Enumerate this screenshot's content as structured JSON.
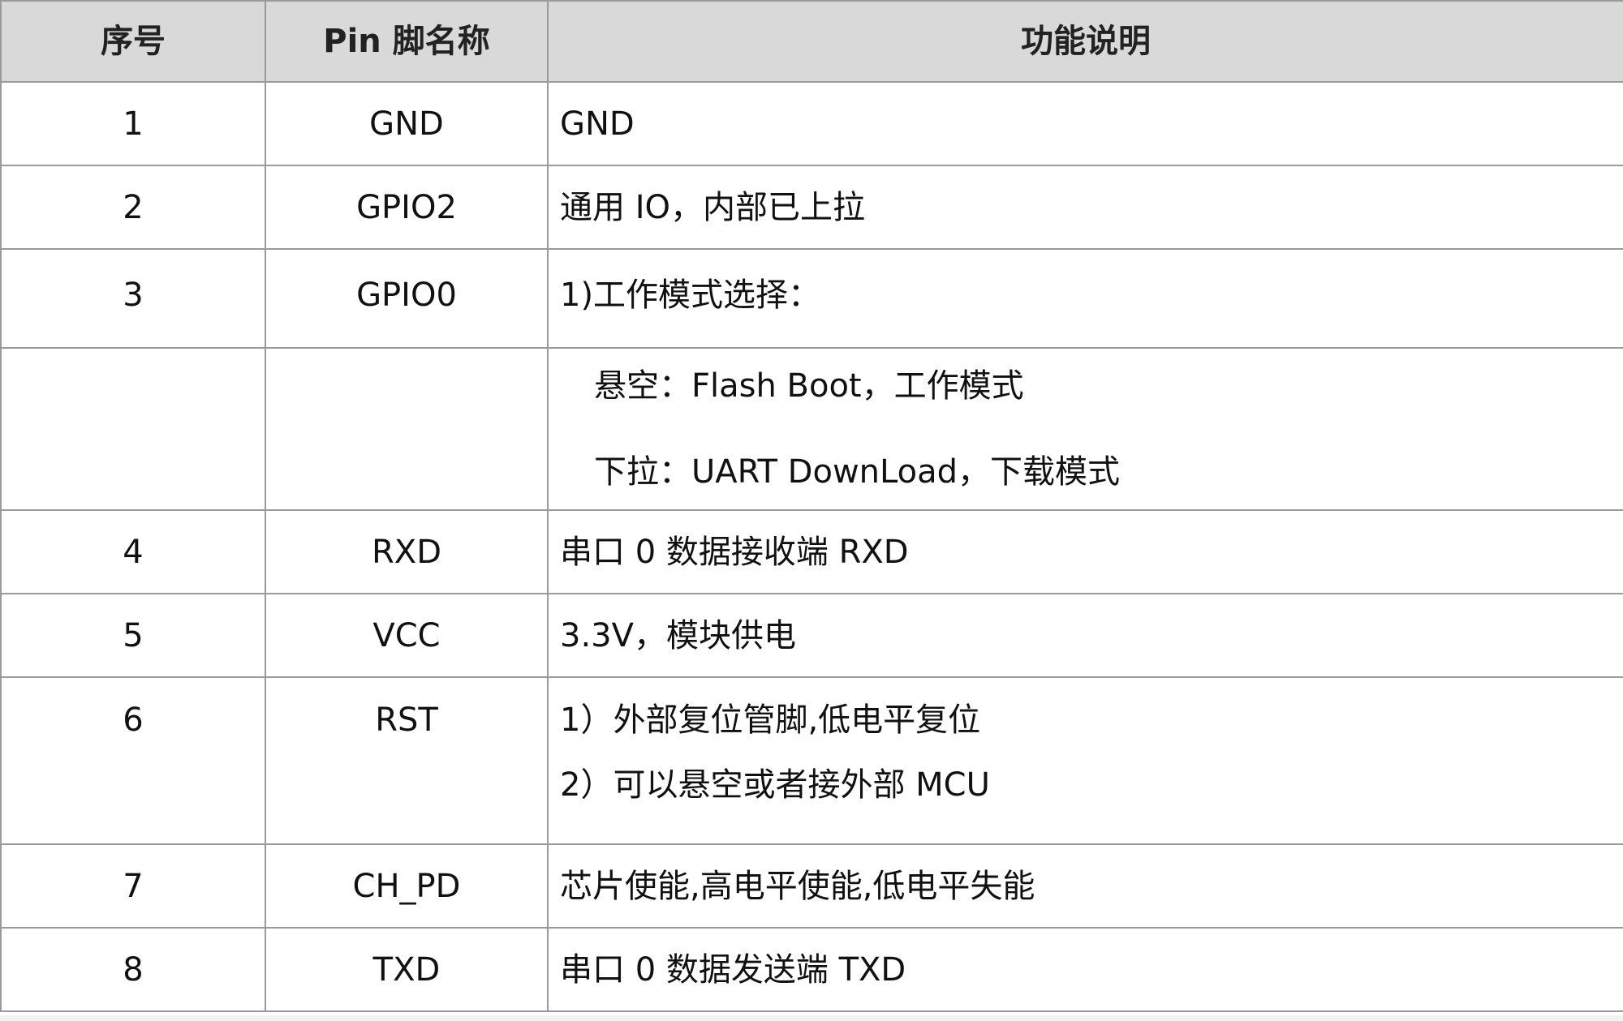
{
  "table": {
    "headers": [
      "序号",
      "Pin 脚名称",
      "功能说明"
    ],
    "rows": [
      {
        "num": "1",
        "pin": "GND",
        "desc": [
          "GND"
        ]
      },
      {
        "num": "2",
        "pin": "GPIO2",
        "desc": [
          "通用 IO，内部已上拉"
        ]
      },
      {
        "num": "3",
        "pin": "GPIO0",
        "desc": [
          "1)工作模式选择："
        ]
      },
      {
        "num": "",
        "pin": "",
        "desc": [
          "悬空：Flash Boot，工作模式",
          "下拉：UART DownLoad，下载模式"
        ]
      },
      {
        "num": "4",
        "pin": "RXD",
        "desc": [
          "串口 0 数据接收端 RXD"
        ]
      },
      {
        "num": "5",
        "pin": "VCC",
        "desc": [
          "3.3V，模块供电"
        ]
      },
      {
        "num": "6",
        "pin": "RST",
        "desc": [
          "1）外部复位管脚,低电平复位",
          "2）可以悬空或者接外部 MCU"
        ]
      },
      {
        "num": "7",
        "pin": "CH_PD",
        "desc": [
          "芯片使能,高电平使能,低电平失能"
        ]
      },
      {
        "num": "8",
        "pin": "TXD",
        "desc": [
          "串口 0 数据发送端 TXD"
        ]
      }
    ]
  }
}
